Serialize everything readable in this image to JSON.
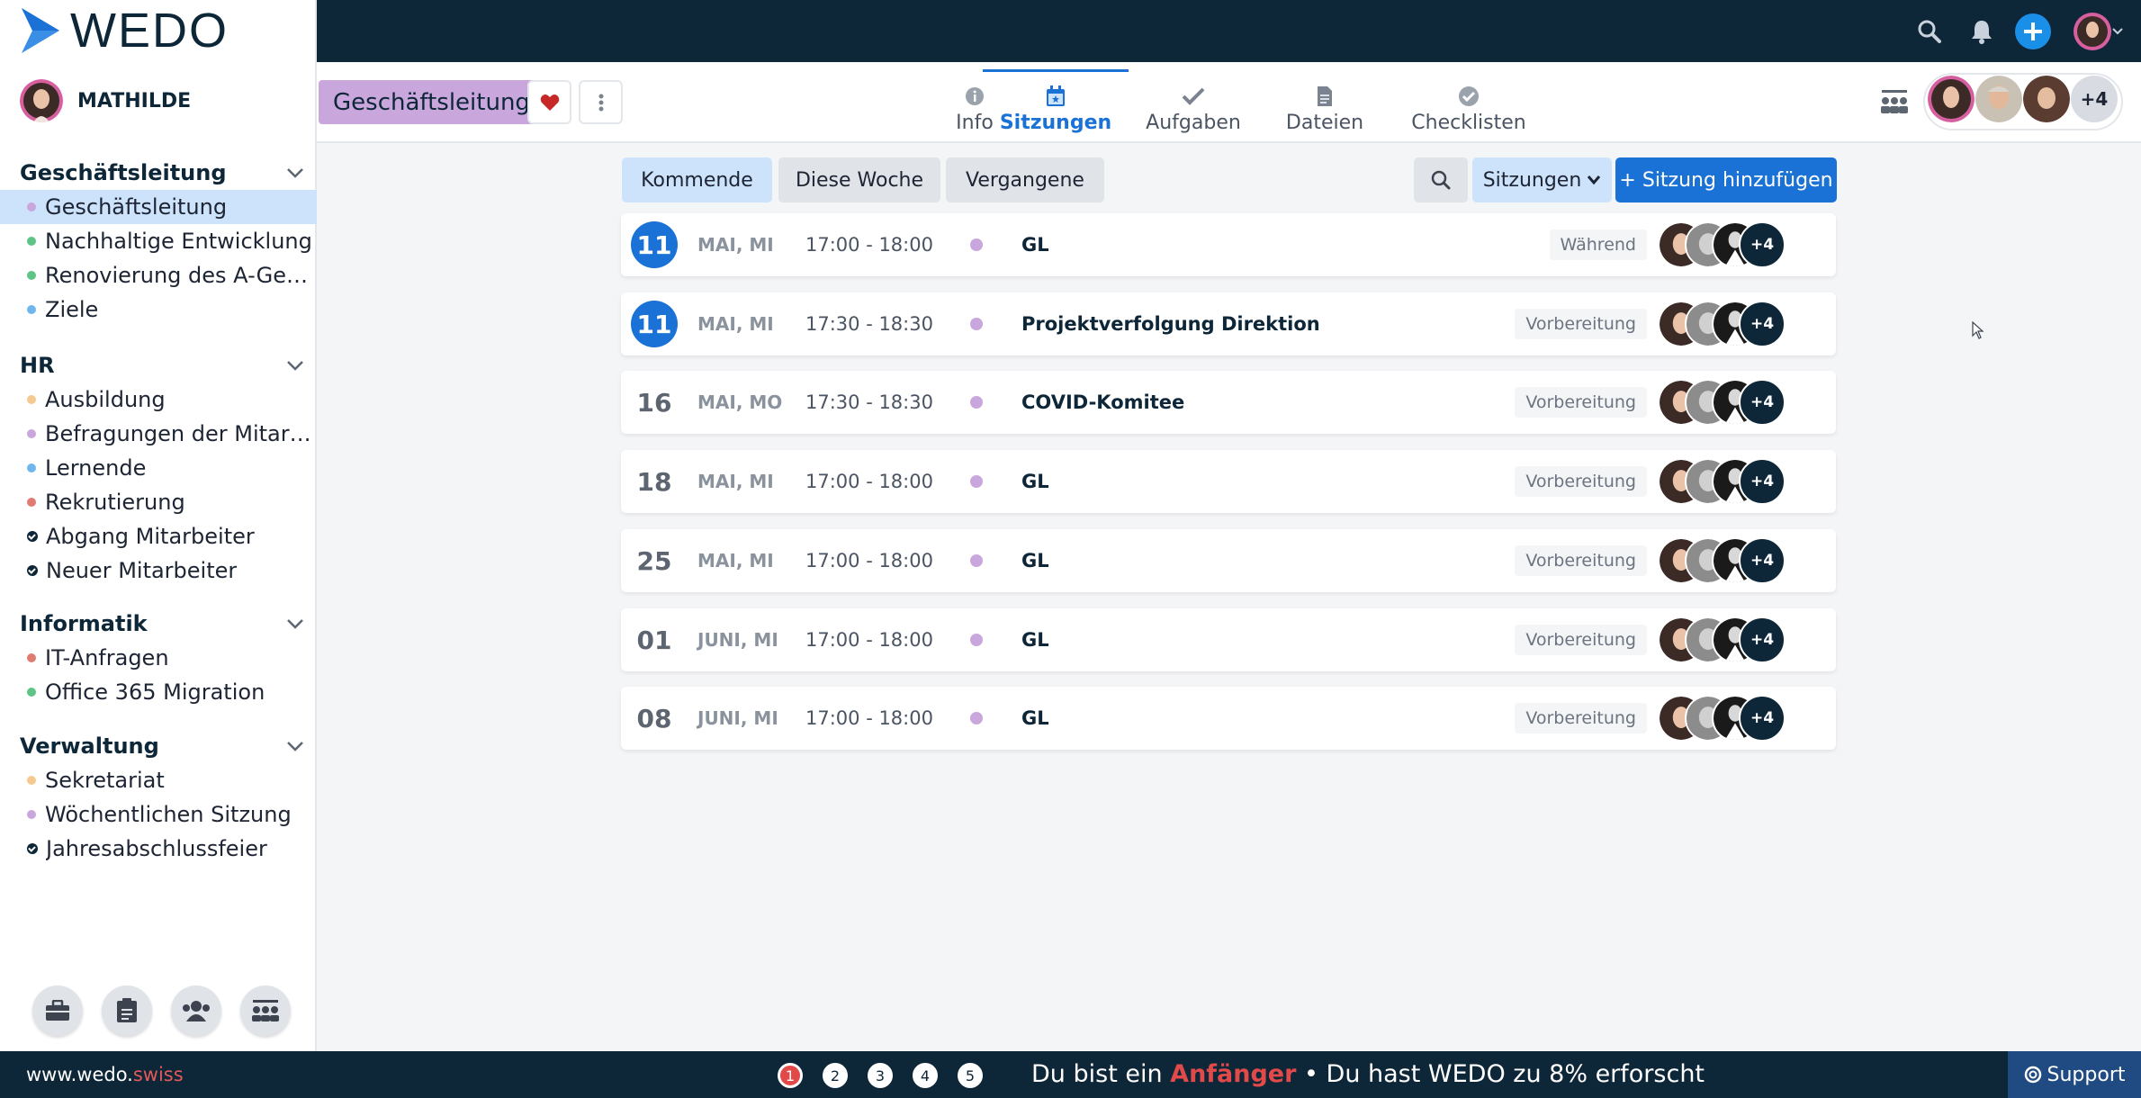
{
  "brand": {
    "logo_text": "WEDO",
    "accent": "#1a72d6",
    "dark": "#0d2638"
  },
  "user": {
    "name": "MATHILDE"
  },
  "sidebar": {
    "sections": [
      {
        "title": "Geschäftsleitung",
        "items": [
          {
            "label": "Geschäftsleitung",
            "color": "#c9a6dc",
            "active": true
          },
          {
            "label": "Nachhaltige Entwicklung",
            "color": "#5ec485"
          },
          {
            "label": "Renovierung des A-Gebäudes",
            "color": "#5ec485"
          },
          {
            "label": "Ziele",
            "color": "#6fb7ea"
          }
        ]
      },
      {
        "title": "HR",
        "items": [
          {
            "label": "Ausbildung",
            "color": "#f5c98f"
          },
          {
            "label": "Befragungen der Mitarbeiter",
            "color": "#c9a6dc"
          },
          {
            "label": "Lernende",
            "color": "#6fb7ea"
          },
          {
            "label": "Rekrutierung",
            "color": "#e07b72"
          },
          {
            "label": "Abgang Mitarbeiter",
            "icon": "check-circle-icon"
          },
          {
            "label": "Neuer Mitarbeiter",
            "icon": "check-circle-icon"
          }
        ]
      },
      {
        "title": "Informatik",
        "items": [
          {
            "label": "IT-Anfragen",
            "color": "#e07b72"
          },
          {
            "label": "Office 365 Migration",
            "color": "#5ec485"
          }
        ]
      },
      {
        "title": "Verwaltung",
        "items": [
          {
            "label": "Sekretariat",
            "color": "#f5c98f"
          },
          {
            "label": "Wöchentlichen Sitzung",
            "color": "#c9a6dc"
          },
          {
            "label": "Jahresabschlussfeier",
            "icon": "check-circle-icon"
          }
        ]
      }
    ],
    "tools": [
      "briefcase-icon",
      "clipboard-icon",
      "users-icon",
      "team-icon"
    ]
  },
  "header": {
    "breadcrumb": "Geschäftsleitung",
    "members_extra": "+4"
  },
  "tabs": [
    {
      "label": "Info",
      "icon": "info-icon"
    },
    {
      "label": "Sitzungen",
      "icon": "calendar-icon",
      "active": true
    },
    {
      "label": "Aufgaben",
      "icon": "check-icon"
    },
    {
      "label": "Dateien",
      "icon": "file-icon"
    },
    {
      "label": "Checklisten",
      "icon": "checklist-icon"
    }
  ],
  "filters": {
    "upcoming": "Kommende",
    "this_week": "Diese Woche",
    "past": "Vergangene",
    "type_select": "Sitzungen",
    "add_button": "+ Sitzung hinzufügen"
  },
  "meetings": [
    {
      "day": "11",
      "month": "MAI, MI",
      "time": "17:00 - 18:00",
      "name": "GL",
      "status": "Während",
      "today": true,
      "extra": "+4"
    },
    {
      "day": "11",
      "month": "MAI, MI",
      "time": "17:30 - 18:30",
      "name": "Projektverfolgung Direktion",
      "status": "Vorbereitung",
      "today": true,
      "extra": "+4"
    },
    {
      "day": "16",
      "month": "MAI, MO",
      "time": "17:30 - 18:30",
      "name": "COVID-Komitee",
      "status": "Vorbereitung",
      "today": false,
      "extra": "+4"
    },
    {
      "day": "18",
      "month": "MAI, MI",
      "time": "17:00 - 18:00",
      "name": "GL",
      "status": "Vorbereitung",
      "today": false,
      "extra": "+4"
    },
    {
      "day": "25",
      "month": "MAI, MI",
      "time": "17:00 - 18:00",
      "name": "GL",
      "status": "Vorbereitung",
      "today": false,
      "extra": "+4"
    },
    {
      "day": "01",
      "month": "JUNI, MI",
      "time": "17:00 - 18:00",
      "name": "GL",
      "status": "Vorbereitung",
      "today": false,
      "extra": "+4"
    },
    {
      "day": "08",
      "month": "JUNI, MI",
      "time": "17:00 - 18:00",
      "name": "GL",
      "status": "Vorbereitung",
      "today": false,
      "extra": "+4"
    }
  ],
  "footer": {
    "site_main": "www.wedo.",
    "site_tld": "swiss",
    "steps": [
      "1",
      "2",
      "3",
      "4",
      "5"
    ],
    "progress_pre": "Du bist ein ",
    "progress_level": "Anfänger",
    "progress_post": " • Du hast WEDO zu 8% erforscht",
    "support": "Support"
  }
}
